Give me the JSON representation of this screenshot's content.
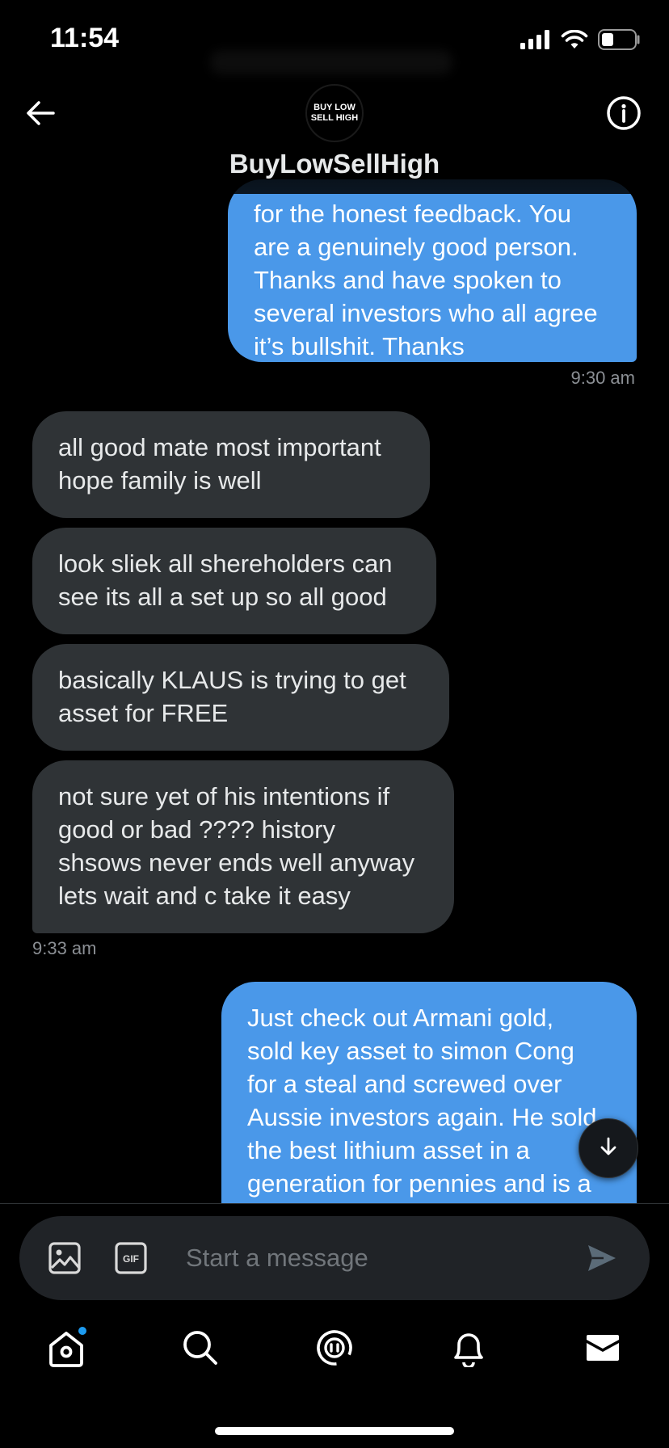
{
  "status_bar": {
    "time": "11:54"
  },
  "header": {
    "contact_name": "BuyLowSellHigh",
    "avatar_text_line1": "BUY LOW",
    "avatar_text_line2": "SELL HIGH"
  },
  "messages": [
    {
      "direction": "outgoing",
      "text": "for the honest feedback. You\nare a genuinely good person.\nThanks and have spoken to\nseveral investors who all agree\nit’s bullshit. Thanks",
      "time": "9:30 am"
    },
    {
      "direction": "incoming",
      "text": "all good mate most important\nhope family is well"
    },
    {
      "direction": "incoming",
      "text": "look sliek all shereholders can\nsee its all a set up so all good"
    },
    {
      "direction": "incoming",
      "text": "basically KLAUS is trying to get\nasset for FREE"
    },
    {
      "direction": "incoming",
      "text": "not sure yet of his intentions if\ngood or bad ???? history\nshsows never ends well anyway\nlets wait and c take it easy",
      "time": "9:33 am"
    },
    {
      "direction": "outgoing",
      "text": "Just check out Armani gold,\nsold key asset to simon Cong\nfor a steal and screwed over\nAussie investors again. He sold\nthe best lithium asset in a\ngeneration for pennies and is a"
    }
  ],
  "composer": {
    "placeholder": "Start a message"
  },
  "colors": {
    "outgoing_bubble": "#4a98e9",
    "incoming_bubble": "#2f3336",
    "background": "#000000",
    "accent": "#1d9bf0"
  }
}
